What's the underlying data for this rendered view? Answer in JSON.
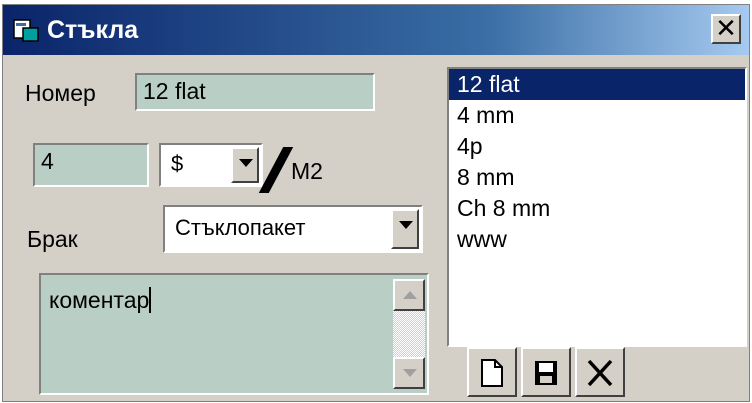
{
  "window": {
    "title": "Стъкла",
    "close_glyph": "✕"
  },
  "form": {
    "number_label": "Номер",
    "number_value": "12 flat",
    "quantity_value": "4",
    "currency_value": "$",
    "unit_label": "М2",
    "defect_label": "Брак",
    "defect_value": "Стъклопакет",
    "comment_value": "коментар"
  },
  "list": {
    "items": [
      "12 flat",
      "4 mm",
      "4p",
      "8 mm",
      "Ch 8 mm",
      "www"
    ],
    "selected_index": 0
  },
  "toolbar": {
    "new_icon": "new-document-icon",
    "save_icon": "save-disk-icon",
    "delete_icon": "delete-x-icon"
  },
  "colors": {
    "titlebar": "#0a246a",
    "field_bg": "#b9cfc6",
    "face": "#d4d0c8",
    "selection": "#0a246a"
  }
}
